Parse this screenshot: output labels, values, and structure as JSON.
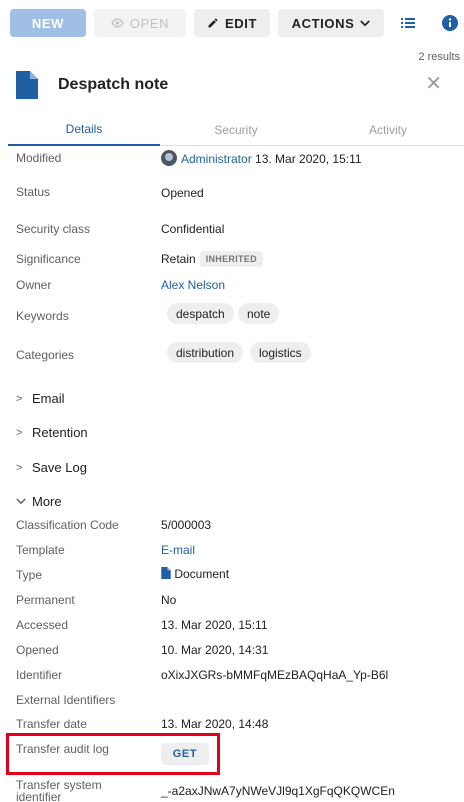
{
  "toolbar": {
    "new_label": "NEW",
    "open_label": "OPEN",
    "edit_label": "EDIT",
    "actions_label": "ACTIONS",
    "results": "2 results"
  },
  "header": {
    "title": "Despatch note"
  },
  "tabs": [
    {
      "label": "Details",
      "active": true
    },
    {
      "label": "Security",
      "active": false
    },
    {
      "label": "Activity",
      "active": false
    }
  ],
  "properties": {
    "modified": {
      "label": "Modified",
      "user": "Administrator",
      "date": "13. Mar 2020, 15:11"
    },
    "status": {
      "label": "Status",
      "value": "Opened"
    },
    "security_class": {
      "label": "Security class",
      "value": "Confidential"
    },
    "significance": {
      "label": "Significance",
      "value": "Retain",
      "badge": "INHERITED"
    },
    "owner": {
      "label": "Owner",
      "value": "Alex Nelson"
    },
    "keywords": {
      "label": "Keywords",
      "chips": [
        "despatch",
        "note"
      ]
    },
    "categories": {
      "label": "Categories",
      "chips": [
        "distribution",
        "logistics"
      ]
    }
  },
  "sections": {
    "email": "Email",
    "retention": "Retention",
    "save_log": "Save Log",
    "more": "More"
  },
  "more": {
    "classification_code": {
      "label": "Classification Code",
      "value": "5/000003"
    },
    "template": {
      "label": "Template",
      "value": "E-mail"
    },
    "type": {
      "label": "Type",
      "value": "Document"
    },
    "permanent": {
      "label": "Permanent",
      "value": "No"
    },
    "accessed": {
      "label": "Accessed",
      "value": "13. Mar 2020, 15:11"
    },
    "opened": {
      "label": "Opened",
      "value": "10. Mar 2020, 14:31"
    },
    "identifier": {
      "label": "Identifier",
      "value": "oXixJXGRs-bMMFqMEzBAQqHaA_Yp-B6l"
    },
    "external_identifiers": {
      "label": "External Identifiers"
    },
    "transfer_date": {
      "label": "Transfer date",
      "value": "13. Mar 2020, 14:48"
    },
    "transfer_audit_log": {
      "label": "Transfer audit log",
      "button": "GET"
    },
    "transfer_system_identifier": {
      "label_line1": "Transfer system",
      "label_line2": "identifier",
      "value": "_-a2axJNwA7yNWeVJl9q1XgFqQKQWCEn"
    }
  },
  "colors": {
    "accent": "#1f5fa3",
    "highlight": "#e3001b",
    "new_button": "#9fbfe6"
  }
}
